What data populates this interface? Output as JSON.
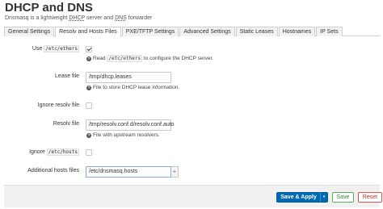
{
  "page": {
    "title": "DHCP and DNS",
    "description_parts": [
      "Dnsmasq is a lightweight ",
      "DHCP",
      " server and ",
      "DNS",
      " forwarder"
    ]
  },
  "tabs": [
    {
      "label": "General Settings",
      "active": false
    },
    {
      "label": "Resolv and Hosts Files",
      "active": true
    },
    {
      "label": "PXE/TFTP Settings",
      "active": false
    },
    {
      "label": "Advanced Settings",
      "active": false
    },
    {
      "label": "Static Leases",
      "active": false
    },
    {
      "label": "Hostnames",
      "active": false
    },
    {
      "label": "IP Sets",
      "active": false
    }
  ],
  "fields": {
    "use_ethers": {
      "label_prefix": "Use ",
      "label_code": "/etc/ethers",
      "checked": true,
      "help_prefix": "Read ",
      "help_code": "/etc/ethers",
      "help_suffix": " to configure the DHCP server."
    },
    "lease_file": {
      "label": "Lease file",
      "value": "/tmp/dhcp.leases",
      "help": "File to store DHCP lease information."
    },
    "ignore_resolv": {
      "label": "Ignore resolv file",
      "checked": false
    },
    "resolv_file": {
      "label": "Resolv file",
      "value": "/tmp/resolv.conf.d/resolv.conf.auto",
      "help": "File with upstream resolvers."
    },
    "ignore_hosts": {
      "label_prefix": "Ignore ",
      "label_code": "/etc/hosts",
      "checked": false
    },
    "additional_hosts": {
      "label": "Additional hosts files",
      "value": "/etc/dnsmasq.hosts",
      "add_symbol": "+"
    }
  },
  "help_icon_glyph": "?",
  "footer": {
    "apply_label": "Save & Apply",
    "dropdown_glyph": "▾",
    "save_label": "Save",
    "reset_label": "Reset"
  },
  "colors": {
    "primary": "#0069b4",
    "save": "#3a8a3a",
    "reset": "#c9302c"
  }
}
